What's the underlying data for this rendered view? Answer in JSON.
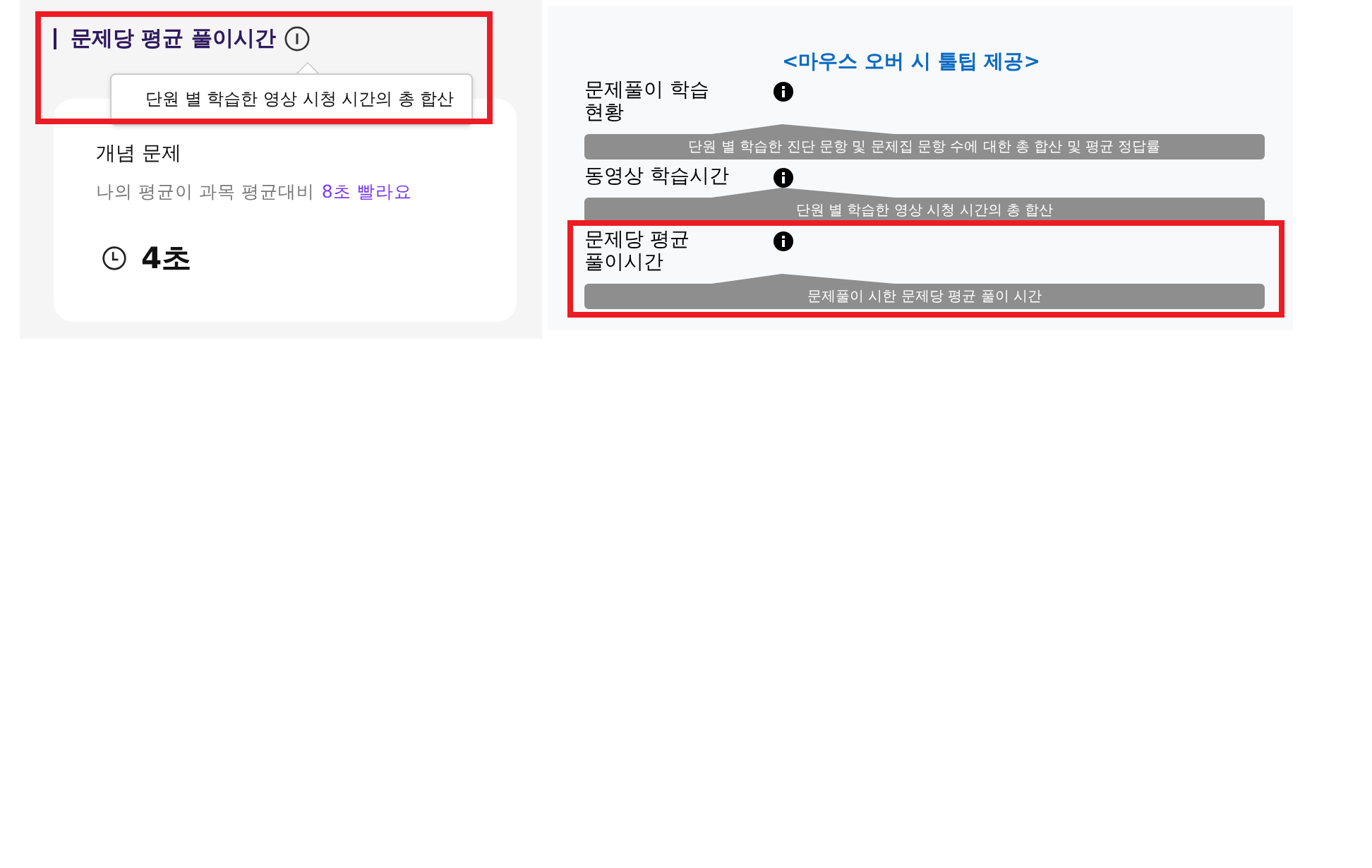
{
  "left_panel": {
    "annotated": true,
    "title": "문제당 평균 풀이시간",
    "tooltip": "단원 별 학습한 영상 시청 시간의 총 합산",
    "card": {
      "title": "개념 문제",
      "comparison": "나의 평균이 과목 평균대비",
      "highlight": "8초 빨라요",
      "time": "4초"
    }
  },
  "right_panel": {
    "annotation": "<마우스 오버 시 툴팁 제공>",
    "rows": [
      {
        "label": "문제풀이 학습 현황",
        "tooltip": "단원 별 학습한 진단 문항 및 문제집 문항 수에 대한 총 합산 및 평균 정답률",
        "annotated": false
      },
      {
        "label": "동영상 학습시간",
        "tooltip": "단원 별 학습한 영상 시청 시간의 총 합산",
        "annotated": false
      },
      {
        "label": "문제당 평균 풀이시간",
        "tooltip": "문제풀이 시한 문제당 평균 풀이 시간",
        "annotated": true
      }
    ]
  }
}
